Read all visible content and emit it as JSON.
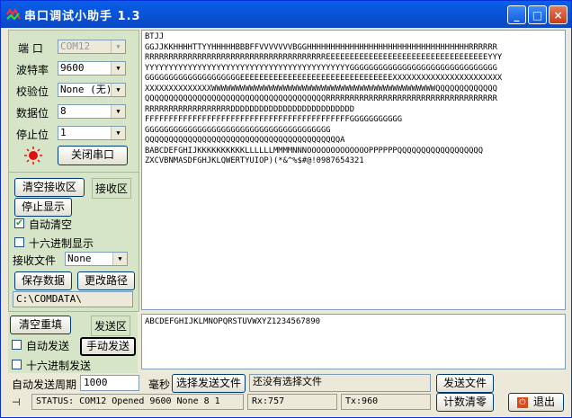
{
  "window": {
    "title": "串口调试小助手 1.3",
    "minimize": "_",
    "maximize": "□",
    "close": "×"
  },
  "port": {
    "port_label": "端  口",
    "port_value": "COM12",
    "baud_label": "波特率",
    "baud_value": "9600",
    "parity_label": "校验位",
    "parity_value": "None (无)",
    "databits_label": "数据位",
    "databits_value": "8",
    "stopbits_label": "停止位",
    "stopbits_value": "1",
    "close_port": "关闭串口"
  },
  "receive": {
    "clear_button": "清空接收区",
    "area_label": "接收区",
    "stop_display": "停止显示",
    "auto_clear": "自动清空",
    "hex_display": "十六进制显示",
    "file_label": "接收文件",
    "file_value": "None",
    "save_data": "保存数据",
    "change_path": "更改路径",
    "path": "C:\\COMDATA\\",
    "lines": [
      "BTJJ",
      "GGJJKKHHHHTTYYHHHHHBBBFFVVVVVVVBGGHHHHHHHHHHHHHHHHHHHHHHHHHHHHHHHHHHRRRRRR",
      "RRRRRRRRRRRRRRRRRRRRRRRRRRRRRRRRRRRRRREEEEEEEEEEEEEEEEEEEEEEEEEEEEEEEEEEYYY",
      "YYYYYYYYYYYYYYYYYYYYYYYYYYYYYYYYYYYYYYYYYYYGGGGGGGGGGGGGGGGGGGGGGGGGGGGGGG",
      "GGGGGGGGGGGGGGGGGGGGEEEEEEEEEEEEEEEEEEEEEEEEEEEEEEEEXXXXXXXXXXXXXXXXXXXXXXX",
      "XXXXXXXXXXXXXXWWWWWWWWWWWWWWWWWWWWWWWWWWWWWWWWWWWWWWWWWWWWWWWQQQQQQQQQQQQQ",
      "QQQQQQQQQQQQQQQQQQQQQQQQQQQQQQQQQQQQQQRRRRRRRRRRRRRRRRRRRRRRRRRRRRRRRRRRRR",
      "RRRRRRRRRRRRRRRRRRDDDDDDDDDDDDDDDDDDDDDDDDDD",
      "FFFFFFFFFFFFFFFFFFFFFFFFFFFFFFFFFFFFFFFFFFFGGGGGGGGGGG",
      "GGGGGGGGGGGGGGGGGGGGGGGGGGGGGGGGGGGGGGG",
      "QQQQQQQQQQQQQQQQQQQQQQQQQQQQQQQQQQQQQQQQQA",
      "BABCDEFGHIJKKKKKKKKKKLLLLLLMMMMNNNOOOOOOOOOOOOOPPPPPPQQQQQQQQQQQQQQQQQQ",
      "ZXCVBNMASDFGHJKLQWERTYUIOP)(*&^%$#@!0987654321"
    ]
  },
  "send": {
    "clear_button": "清空重填",
    "area_label": "发送区",
    "auto_send": "自动发送",
    "manual_send": "手动发送",
    "hex_send": "十六进制发送",
    "period_label": "自动发送周期",
    "period_value": "1000",
    "ms_label": "毫秒",
    "choose_file": "选择发送文件",
    "file_status": "还没有选择文件",
    "send_file": "发送文件",
    "content": "ABCDEFGHIJKLMNOPQRSTUVWXYZ1234567890"
  },
  "status": {
    "text": "STATUS: COM12 Opened 9600 None  8 1",
    "rx": "Rx:757",
    "tx": "Tx:960",
    "reset_count": "计数清零",
    "exit": "退出"
  },
  "colors": {
    "title_bar": "#0A5FE8",
    "panel": "#D6E5C8",
    "led": "#E01010"
  }
}
